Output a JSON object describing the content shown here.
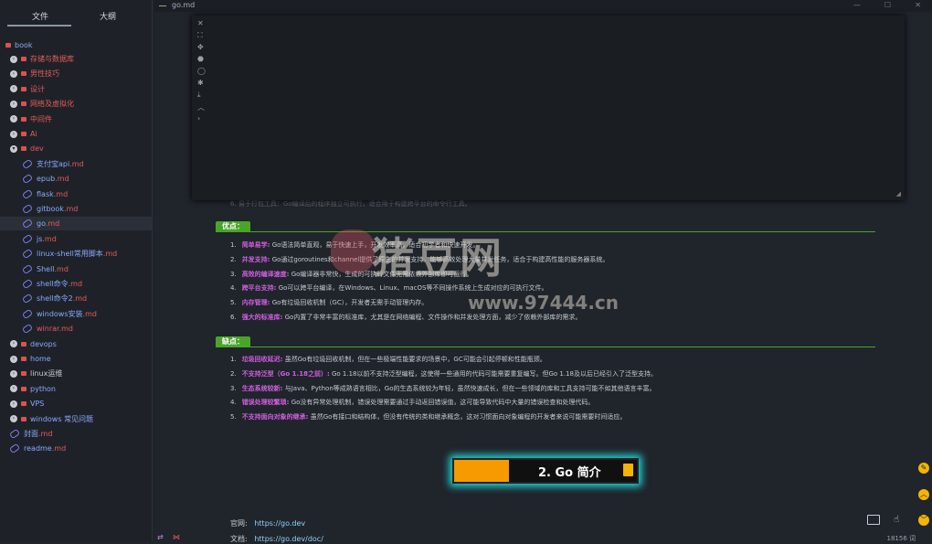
{
  "window": {
    "file_name": "go.md",
    "controls": {
      "minimize": "—",
      "maximize": "☐",
      "close": "✕"
    }
  },
  "sidebar": {
    "tabs": [
      {
        "label": "文件"
      },
      {
        "label": "大纲"
      }
    ],
    "root": "book",
    "items": [
      {
        "label": "存储与数据库",
        "type": "folder"
      },
      {
        "label": "男性技巧",
        "type": "folder"
      },
      {
        "label": "设计",
        "type": "folder"
      },
      {
        "label": "网络及虚拟化",
        "type": "folder"
      },
      {
        "label": "中间件",
        "type": "folder"
      },
      {
        "label": "Ai",
        "type": "folder"
      },
      {
        "label": "dev",
        "type": "folder-open"
      },
      {
        "name": "支付宝api",
        "ext": ".md"
      },
      {
        "name": "epub",
        "ext": ".md"
      },
      {
        "name": "flask",
        "ext": ".md"
      },
      {
        "name": "gitbook",
        "ext": ".md"
      },
      {
        "name": "go",
        "ext": ".md"
      },
      {
        "name": "js",
        "ext": ".md"
      },
      {
        "name": "linux-shell常用脚本",
        "ext": ".md"
      },
      {
        "name": "Shell",
        "ext": ".md"
      },
      {
        "name": "shell命令",
        "ext": ".md"
      },
      {
        "name": "shell命令2",
        "ext": ".md"
      },
      {
        "name": "windows安装",
        "ext": ".md"
      },
      {
        "name": "winrar",
        "ext": ".md"
      },
      {
        "label": "devops",
        "type": "folder"
      },
      {
        "label": "home",
        "type": "folder"
      },
      {
        "label": "linux运维",
        "type": "folder"
      },
      {
        "label": "python",
        "type": "folder"
      },
      {
        "label": "VPS",
        "type": "folder"
      },
      {
        "label": "windows 常见问题",
        "type": "folder"
      },
      {
        "name": "封面",
        "ext": ".md"
      },
      {
        "name": "readme",
        "ext": ".md"
      }
    ],
    "bottom_icons": [
      "⇄",
      "⋈"
    ]
  },
  "panel": {
    "tools": [
      "✕",
      "⛶",
      "✥",
      "⬣",
      "◯",
      "✱",
      "⤓",
      "︿",
      "›"
    ]
  },
  "doc": {
    "faded_line": "6. 易于打包工具：Go编译后的程序独立可执行，适合用于构建跨平台的命令行工具。",
    "advantages_title": "优点：",
    "advantages": [
      {
        "num": "1.",
        "key": "简单易学:",
        "text": " Go语法简单直观，易于快速上手，开发效率高，适合初学者和快速开发。"
      },
      {
        "num": "2.",
        "key": "并发支持:",
        "text": " Go通过goroutines和channel提供了原生的并发支持，能够高效处理大量并发任务，适合于构建高性能的服务器系统。"
      },
      {
        "num": "3.",
        "key": "高效的编译速度:",
        "text": " Go编译器非常快，生成的可执行文件无需依赖外部库即可运行。"
      },
      {
        "num": "4.",
        "key": "跨平台支持:",
        "text": " Go可以跨平台编译，在Windows、Linux、macOS等不同操作系统上生成对应的可执行文件。"
      },
      {
        "num": "5.",
        "key": "内存管理:",
        "text": " Go有垃圾回收机制（GC），开发者无需手动管理内存。"
      },
      {
        "num": "6.",
        "key": "强大的标准库:",
        "text": " Go内置了非常丰富的标准库，尤其是在网络编程、文件操作和并发处理方面，减少了依赖外部库的需求。"
      }
    ],
    "disadvantages_title": "缺点：",
    "disadvantages": [
      {
        "num": "1.",
        "key": "垃圾回收延迟:",
        "text": " 虽然Go有垃圾回收机制，但在一些极端性能要求的场景中，GC可能会引起停顿和性能瓶颈。"
      },
      {
        "num": "2.",
        "key": "不支持泛型（Go 1.18之前）:",
        "text": " Go 1.18以前不支持泛型编程，这使得一些通用的代码可能需要重复编写。但Go 1.18及以后已经引入了泛型支持。"
      },
      {
        "num": "3.",
        "key": "生态系统较新:",
        "text": " 与Java、Python等成熟语言相比，Go的生态系统较为年轻，虽然快速成长，但在一些领域的库和工具支持可能不如其他语言丰富。"
      },
      {
        "num": "4.",
        "key": "错误处理较繁琐:",
        "text": " Go没有异常处理机制，错误处理需要通过手动返回错误值，这可能导致代码中大量的错误检查和处理代码。"
      },
      {
        "num": "5.",
        "key": "不支持面向对象的继承:",
        "text": " 虽然Go有接口和结构体，但没有传统的类和继承概念，这对习惯面向对象编程的开发者来说可能需要时间适应。"
      }
    ],
    "banner_title": "2. Go 简介",
    "links": [
      {
        "label": "官网:",
        "value": "https://go.dev"
      },
      {
        "label": "文档:",
        "value": "https://go.dev/doc/"
      }
    ],
    "word_count": "18156 词"
  },
  "watermark": {
    "text": "猪豆网",
    "url": "www.97444.cn"
  },
  "colors": {
    "accent_green": "#49a52a",
    "keyword": "#d05fe0",
    "banner_orange": "#f59a00",
    "glow": "#1fe0e0"
  }
}
